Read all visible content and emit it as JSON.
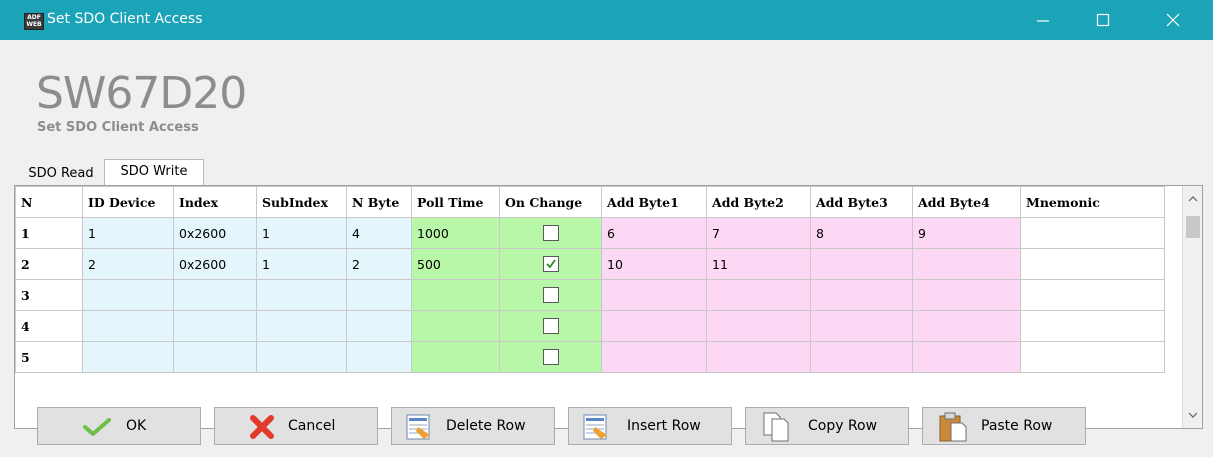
{
  "window": {
    "title": "Set SDO Client Access",
    "app_icon_text": "ADF WEB"
  },
  "header": {
    "title": "SW67D20",
    "subtitle": "Set SDO Client Access"
  },
  "tabs": [
    {
      "label": "SDO Read",
      "active": false
    },
    {
      "label": "SDO Write",
      "active": true
    }
  ],
  "table": {
    "columns": [
      "N",
      "ID Device",
      "Index",
      "SubIndex",
      "N Byte",
      "Poll Time",
      "On Change",
      "Add Byte1",
      "Add Byte2",
      "Add Byte3",
      "Add Byte4",
      "Mnemonic"
    ],
    "rows": [
      {
        "n": "1",
        "id_device": "1",
        "index": "0x2600",
        "subindex": "1",
        "n_byte": "4",
        "poll_time": "1000",
        "on_change": false,
        "add1": "6",
        "add2": "7",
        "add3": "8",
        "add4": "9",
        "mnemonic": ""
      },
      {
        "n": "2",
        "id_device": "2",
        "index": "0x2600",
        "subindex": "1",
        "n_byte": "2",
        "poll_time": "500",
        "on_change": true,
        "add1": "10",
        "add2": "11",
        "add3": "",
        "add4": "",
        "mnemonic": ""
      },
      {
        "n": "3",
        "id_device": "",
        "index": "",
        "subindex": "",
        "n_byte": "",
        "poll_time": "",
        "on_change": false,
        "add1": "",
        "add2": "",
        "add3": "",
        "add4": "",
        "mnemonic": ""
      },
      {
        "n": "4",
        "id_device": "",
        "index": "",
        "subindex": "",
        "n_byte": "",
        "poll_time": "",
        "on_change": false,
        "add1": "",
        "add2": "",
        "add3": "",
        "add4": "",
        "mnemonic": ""
      },
      {
        "n": "5",
        "id_device": "",
        "index": "",
        "subindex": "",
        "n_byte": "",
        "poll_time": "",
        "on_change": false,
        "add1": "",
        "add2": "",
        "add3": "",
        "add4": "",
        "mnemonic": ""
      }
    ]
  },
  "buttons": {
    "ok": "OK",
    "cancel": "Cancel",
    "delete_row": "Delete Row",
    "insert_row": "Insert Row",
    "copy_row": "Copy Row",
    "paste_row": "Paste Row"
  },
  "colors": {
    "titlebar": "#1ba3b8",
    "id_cols": "#e4f6fc",
    "poll_cols": "#b7f7a7",
    "add_cols": "#fcd8f4"
  }
}
